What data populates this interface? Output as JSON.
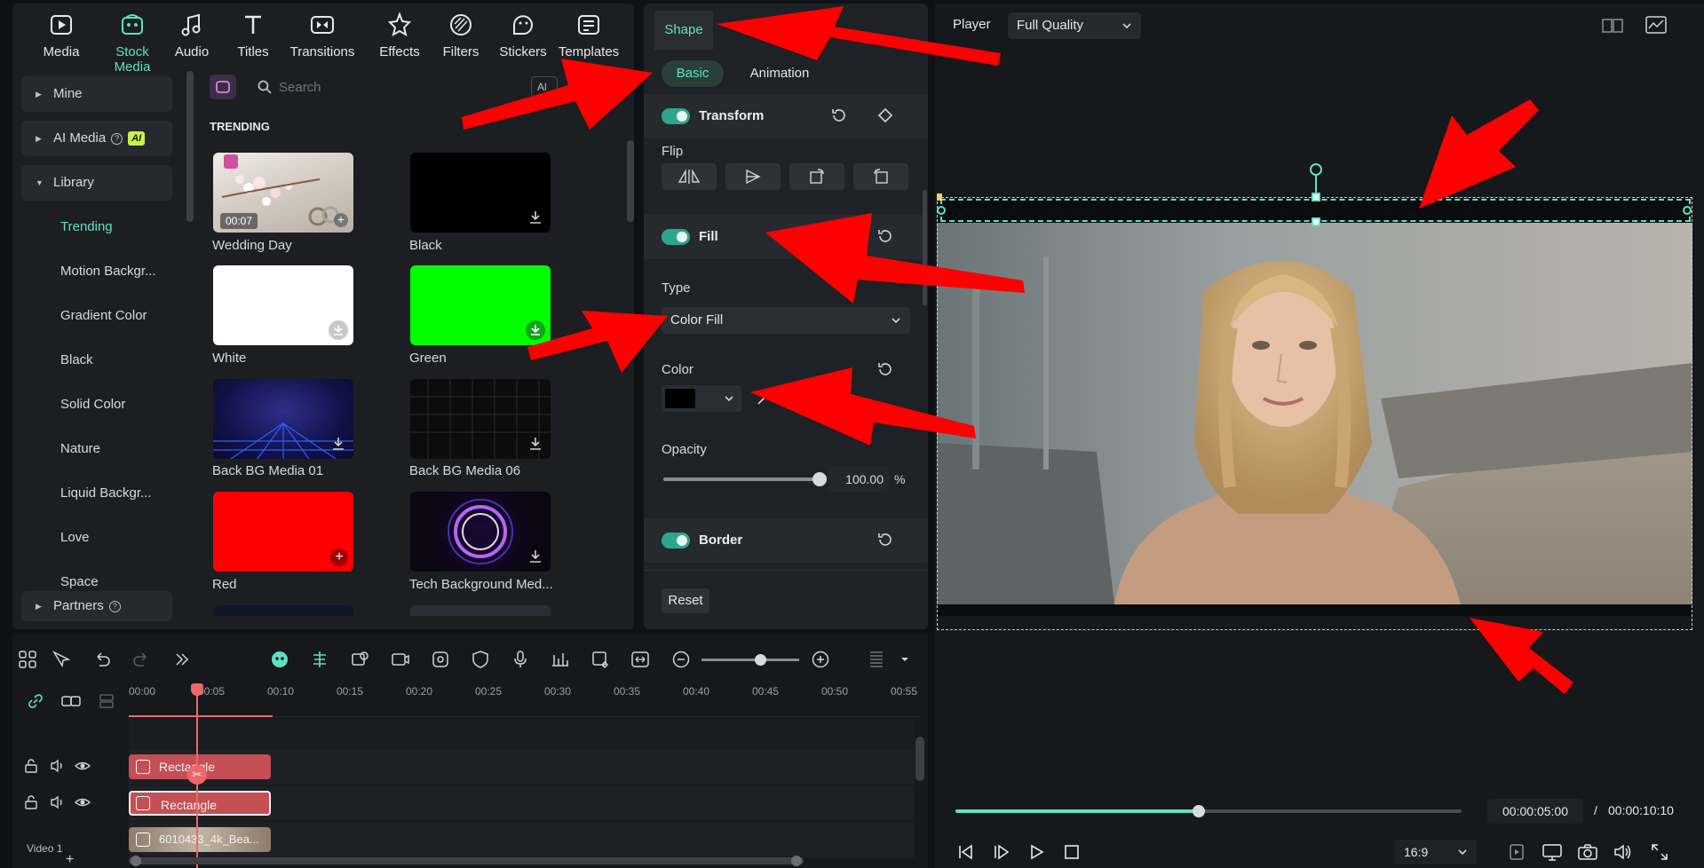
{
  "media_tabs": [
    {
      "label": "Media",
      "icon": "media-icon"
    },
    {
      "label": "Stock Media",
      "icon": "stock-media-icon",
      "active": true
    },
    {
      "label": "Audio",
      "icon": "audio-icon"
    },
    {
      "label": "Titles",
      "icon": "titles-icon"
    },
    {
      "label": "Transitions",
      "icon": "transitions-icon"
    },
    {
      "label": "Effects",
      "icon": "effects-icon"
    },
    {
      "label": "Filters",
      "icon": "filters-icon"
    },
    {
      "label": "Stickers",
      "icon": "stickers-icon"
    },
    {
      "label": "Templates",
      "icon": "templates-icon"
    }
  ],
  "sidebar": {
    "items": [
      {
        "label": "Mine"
      },
      {
        "label": "AI Media",
        "badge": "AI"
      },
      {
        "label": "Library"
      },
      {
        "label": "Trending"
      },
      {
        "label": "Motion Backgr..."
      },
      {
        "label": "Gradient Color"
      },
      {
        "label": "Black"
      },
      {
        "label": "Solid Color"
      },
      {
        "label": "Nature"
      },
      {
        "label": "Liquid Backgr..."
      },
      {
        "label": "Love"
      },
      {
        "label": "Space"
      },
      {
        "label": "Partners"
      }
    ]
  },
  "search": {
    "placeholder": "Search",
    "filter_label": "Al"
  },
  "grid": {
    "section_title": "TRENDING",
    "items": [
      {
        "label": "Wedding Day",
        "duration": "00:07"
      },
      {
        "label": "Black"
      },
      {
        "label": "White"
      },
      {
        "label": "Green"
      },
      {
        "label": "Back BG Media 01"
      },
      {
        "label": "Back BG Media 06"
      },
      {
        "label": "Red"
      },
      {
        "label": "Tech Background Med..."
      }
    ]
  },
  "properties": {
    "tab": "Shape",
    "subtabs": [
      "Basic",
      "Animation"
    ],
    "transform": {
      "title": "Transform"
    },
    "flip_label": "Flip",
    "fill": {
      "title": "Fill",
      "type_label": "Type",
      "type_value": "Color Fill",
      "color_label": "Color",
      "color_value": "#000000"
    },
    "opacity": {
      "label": "Opacity",
      "value": "100.00",
      "unit": "%",
      "level": 1.0
    },
    "border": {
      "title": "Border"
    },
    "reset_label": "Reset"
  },
  "player": {
    "label": "Player",
    "quality": "Full Quality",
    "current_time": "00:00:05:00",
    "separator": "/",
    "total_time": "00:00:10:10",
    "progress": 0.48,
    "aspect_ratio": "16:9"
  },
  "timeline": {
    "ticks": [
      "00:00",
      "00:05",
      "00:10",
      "00:15",
      "00:20",
      "00:25",
      "00:30",
      "00:35",
      "00:40",
      "00:45",
      "00:50",
      "00:55"
    ],
    "clips": [
      {
        "label": "Rectangle"
      },
      {
        "label": "Rectangle"
      },
      {
        "label": "6010433_4k_Bea..."
      }
    ],
    "track_label": "Video 1",
    "zoom_level": 0.6
  },
  "colors": {
    "accent": "#5fe0c4",
    "annotation": "#ff0000",
    "playhead": "#f0676b",
    "clip_rect": "#c44f55"
  }
}
